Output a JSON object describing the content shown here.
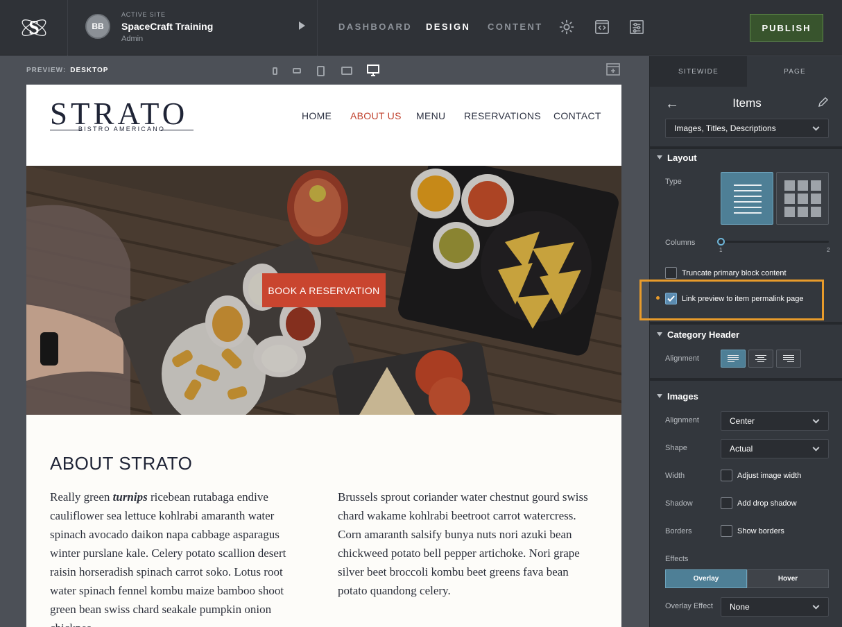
{
  "app": {
    "active_site_label": "ACTIVE SITE",
    "avatar_initials": "BB",
    "site_name": "SpaceCraft Training",
    "role": "Admin",
    "nav": [
      "DASHBOARD",
      "DESIGN",
      "CONTENT"
    ],
    "active_nav": "DESIGN",
    "publish_label": "PUBLISH"
  },
  "preview": {
    "label": "PREVIEW:",
    "mode": "DESKTOP"
  },
  "website": {
    "brand": "STRATO",
    "brand_sub": "BISTRO AMERICANO",
    "menu": [
      "HOME",
      "ABOUT US",
      "MENU",
      "RESERVATIONS",
      "CONTACT"
    ],
    "active_menu": "ABOUT US",
    "cta": "BOOK A RESERVATION",
    "about_title": "ABOUT STRATO",
    "col1_pre": "Really green ",
    "col1_em": "turnips",
    "col1_post": " ricebean rutabaga endive cauliflower sea lettuce kohlrabi amaranth water spinach avocado daikon napa cabbage asparagus winter purslane kale. Celery potato scallion desert raisin horseradish spinach carrot soko. Lotus root water spinach fennel kombu maize bamboo shoot green bean swiss chard seakale pumpkin onion chickpea.",
    "col2": "Brussels sprout coriander water chestnut gourd swiss chard wakame kohlrabi beetroot carrot watercress. Corn amaranth salsify bunya nuts nori azuki bean chickweed potato bell pepper artichoke. Nori grape silver beet broccoli kombu beet greens fava bean potato quandong celery."
  },
  "panel": {
    "tabs": [
      "SITEWIDE",
      "PAGE"
    ],
    "active_tab": "PAGE",
    "title": "Items",
    "items_dropdown": "Images, Titles, Descriptions",
    "layout": {
      "heading": "Layout",
      "type_label": "Type",
      "columns_label": "Columns",
      "columns_min": "1",
      "columns_max": "2",
      "truncate_label": "Truncate primary block content",
      "truncate_checked": false,
      "link_preview_label": "Link preview to item permalink page",
      "link_preview_checked": true
    },
    "category_header": {
      "heading": "Category Header",
      "alignment_label": "Alignment"
    },
    "images": {
      "heading": "Images",
      "alignment_label": "Alignment",
      "alignment_value": "Center",
      "shape_label": "Shape",
      "shape_value": "Actual",
      "width_label": "Width",
      "width_cb": "Adjust image width",
      "shadow_label": "Shadow",
      "shadow_cb": "Add drop shadow",
      "borders_label": "Borders",
      "borders_cb": "Show borders",
      "effects_label": "Effects",
      "effect_tabs": [
        "Overlay",
        "Hover"
      ],
      "overlay_effect_label": "Overlay Effect",
      "overlay_effect_value": "None"
    }
  },
  "colors": {
    "accent": "#c9452f",
    "highlight": "#e89b2b",
    "publish": "#38542d",
    "selected": "#4e7f96"
  }
}
